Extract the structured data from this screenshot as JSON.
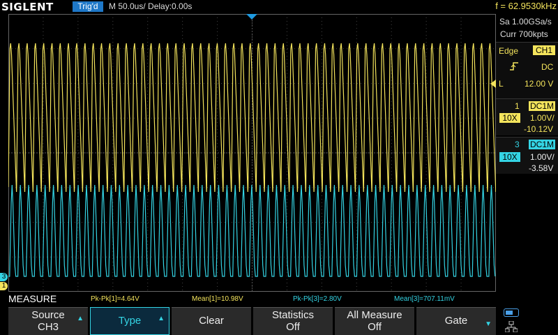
{
  "header": {
    "brand": "SIGLENT",
    "trigger_status": "Trig'd",
    "timebase": "M 50.0us/  Delay:0.00s",
    "frequency": "f = 62.9530kHz"
  },
  "acquisition": {
    "sample_rate": "Sa 1.00GSa/s",
    "memory": "Curr 700kpts"
  },
  "trigger": {
    "type": "Edge",
    "source": "CH1",
    "coupling": "DC",
    "level_label": "L",
    "level": "12.00 V"
  },
  "channels": [
    {
      "number": "1",
      "coupling": "DC1M",
      "probe": "10X",
      "scale": "1.00V/",
      "offset": "-10.12V",
      "color": "#f4e45c"
    },
    {
      "number": "3",
      "coupling": "DC1M",
      "probe": "10X",
      "scale": "1.00V/",
      "offset": "-3.58V",
      "color": "#34d4e4"
    }
  ],
  "markers": {
    "ch3": "3",
    "ch1": "1"
  },
  "measure": {
    "title": "MEASURE",
    "items": [
      {
        "label": "Pk-Pk[1]=4.64V",
        "channel": "1"
      },
      {
        "label": "Mean[1]=10.98V",
        "channel": "1"
      },
      {
        "label": "Pk-Pk[3]=2.80V",
        "channel": "3"
      },
      {
        "label": "Mean[3]=707.11mV",
        "channel": "3"
      }
    ]
  },
  "softkeys": [
    {
      "line1": "Source",
      "line2": "CH3"
    },
    {
      "line1": "Type",
      "line2": ""
    },
    {
      "line1": "Clear",
      "line2": ""
    },
    {
      "line1": "Statistics",
      "line2": "Off"
    },
    {
      "line1": "All Measure",
      "line2": "Off"
    },
    {
      "line1": "Gate",
      "line2": ""
    }
  ],
  "colors": {
    "ch1": "#f4e45c",
    "ch3": "#34d4e4",
    "accent": "#1e78c8"
  },
  "icons": {
    "status": "usb-icon",
    "network": "network-icon"
  },
  "waveforms": {
    "ch1": {
      "cycles": 59
    },
    "ch3": {
      "cycles": 59
    }
  }
}
